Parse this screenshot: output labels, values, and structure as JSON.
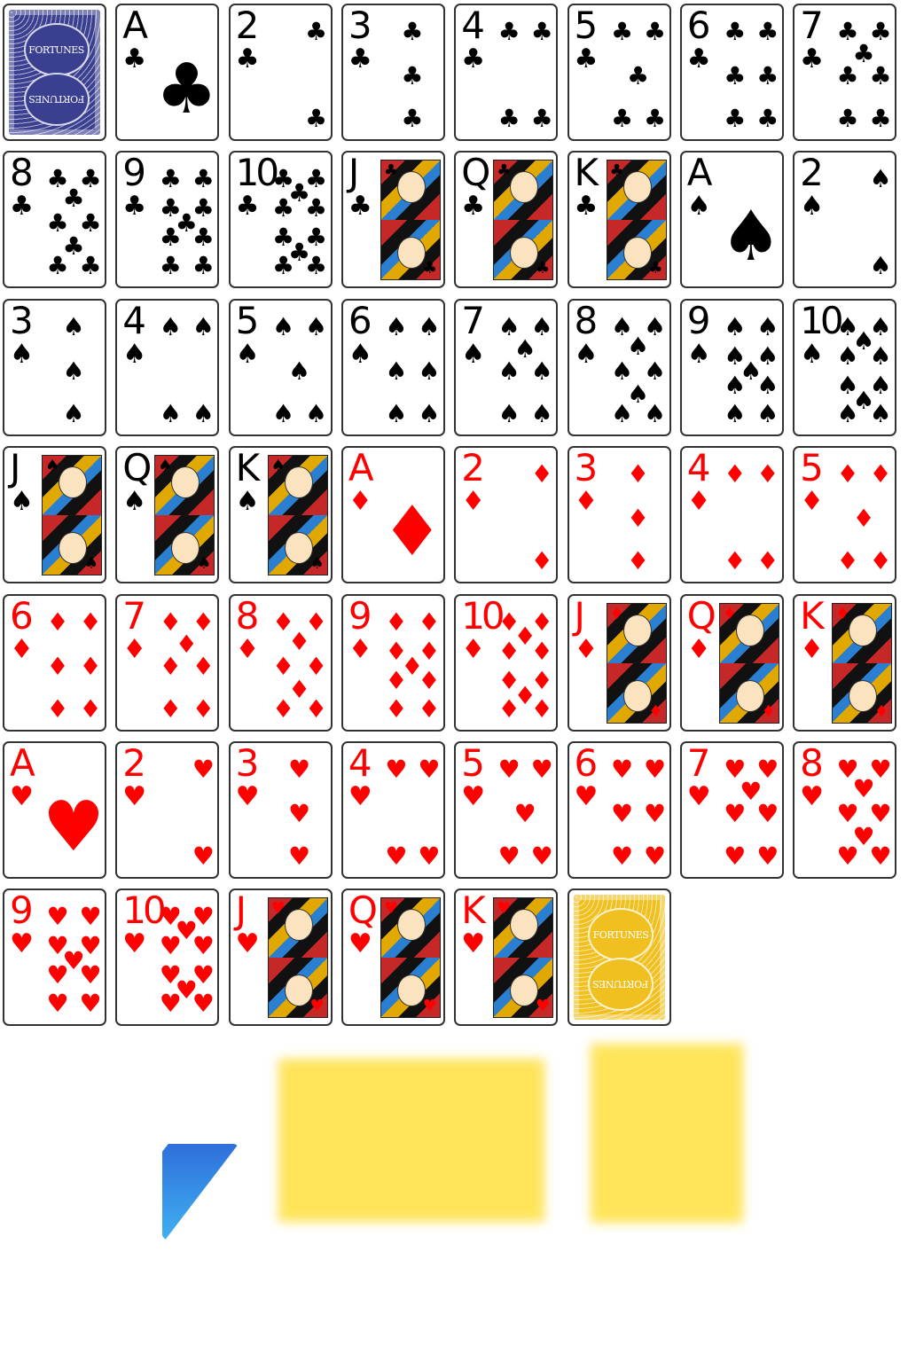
{
  "colors": {
    "black": "#000000",
    "red": "#ff0000",
    "blue_back": "#3a3f8f",
    "gold_back": "#f0c020",
    "triangle_top": "#2f6fdc",
    "triangle_bottom": "#3fb0f0",
    "yellow": "#ffe45a"
  },
  "back_label": "FORTUNES",
  "cards": [
    {
      "type": "back",
      "variant": "blue"
    },
    {
      "rank": "A",
      "suit": "♣",
      "color": "black"
    },
    {
      "rank": "2",
      "suit": "♣",
      "color": "black"
    },
    {
      "rank": "3",
      "suit": "♣",
      "color": "black"
    },
    {
      "rank": "4",
      "suit": "♣",
      "color": "black"
    },
    {
      "rank": "5",
      "suit": "♣",
      "color": "black"
    },
    {
      "rank": "6",
      "suit": "♣",
      "color": "black"
    },
    {
      "rank": "7",
      "suit": "♣",
      "color": "black"
    },
    {
      "rank": "8",
      "suit": "♣",
      "color": "black"
    },
    {
      "rank": "9",
      "suit": "♣",
      "color": "black"
    },
    {
      "rank": "10",
      "suit": "♣",
      "color": "black"
    },
    {
      "rank": "J",
      "suit": "♣",
      "color": "black"
    },
    {
      "rank": "Q",
      "suit": "♣",
      "color": "black"
    },
    {
      "rank": "K",
      "suit": "♣",
      "color": "black"
    },
    {
      "rank": "A",
      "suit": "♠",
      "color": "black"
    },
    {
      "rank": "2",
      "suit": "♠",
      "color": "black"
    },
    {
      "rank": "3",
      "suit": "♠",
      "color": "black"
    },
    {
      "rank": "4",
      "suit": "♠",
      "color": "black"
    },
    {
      "rank": "5",
      "suit": "♠",
      "color": "black"
    },
    {
      "rank": "6",
      "suit": "♠",
      "color": "black"
    },
    {
      "rank": "7",
      "suit": "♠",
      "color": "black"
    },
    {
      "rank": "8",
      "suit": "♠",
      "color": "black"
    },
    {
      "rank": "9",
      "suit": "♠",
      "color": "black"
    },
    {
      "rank": "10",
      "suit": "♠",
      "color": "black"
    },
    {
      "rank": "J",
      "suit": "♠",
      "color": "black"
    },
    {
      "rank": "Q",
      "suit": "♠",
      "color": "black"
    },
    {
      "rank": "K",
      "suit": "♠",
      "color": "black"
    },
    {
      "rank": "A",
      "suit": "♦",
      "color": "red"
    },
    {
      "rank": "2",
      "suit": "♦",
      "color": "red"
    },
    {
      "rank": "3",
      "suit": "♦",
      "color": "red"
    },
    {
      "rank": "4",
      "suit": "♦",
      "color": "red"
    },
    {
      "rank": "5",
      "suit": "♦",
      "color": "red"
    },
    {
      "rank": "6",
      "suit": "♦",
      "color": "red"
    },
    {
      "rank": "7",
      "suit": "♦",
      "color": "red"
    },
    {
      "rank": "8",
      "suit": "♦",
      "color": "red"
    },
    {
      "rank": "9",
      "suit": "♦",
      "color": "red"
    },
    {
      "rank": "10",
      "suit": "♦",
      "color": "red"
    },
    {
      "rank": "J",
      "suit": "♦",
      "color": "red"
    },
    {
      "rank": "Q",
      "suit": "♦",
      "color": "red"
    },
    {
      "rank": "K",
      "suit": "♦",
      "color": "red"
    },
    {
      "rank": "A",
      "suit": "♥",
      "color": "red"
    },
    {
      "rank": "2",
      "suit": "♥",
      "color": "red"
    },
    {
      "rank": "3",
      "suit": "♥",
      "color": "red"
    },
    {
      "rank": "4",
      "suit": "♥",
      "color": "red"
    },
    {
      "rank": "5",
      "suit": "♥",
      "color": "red"
    },
    {
      "rank": "6",
      "suit": "♥",
      "color": "red"
    },
    {
      "rank": "7",
      "suit": "♥",
      "color": "red"
    },
    {
      "rank": "8",
      "suit": "♥",
      "color": "red"
    },
    {
      "rank": "9",
      "suit": "♥",
      "color": "red"
    },
    {
      "rank": "10",
      "suit": "♥",
      "color": "red"
    },
    {
      "rank": "J",
      "suit": "♥",
      "color": "red"
    },
    {
      "rank": "Q",
      "suit": "♥",
      "color": "red"
    },
    {
      "rank": "K",
      "suit": "♥",
      "color": "red"
    },
    {
      "type": "back",
      "variant": "gold"
    }
  ]
}
